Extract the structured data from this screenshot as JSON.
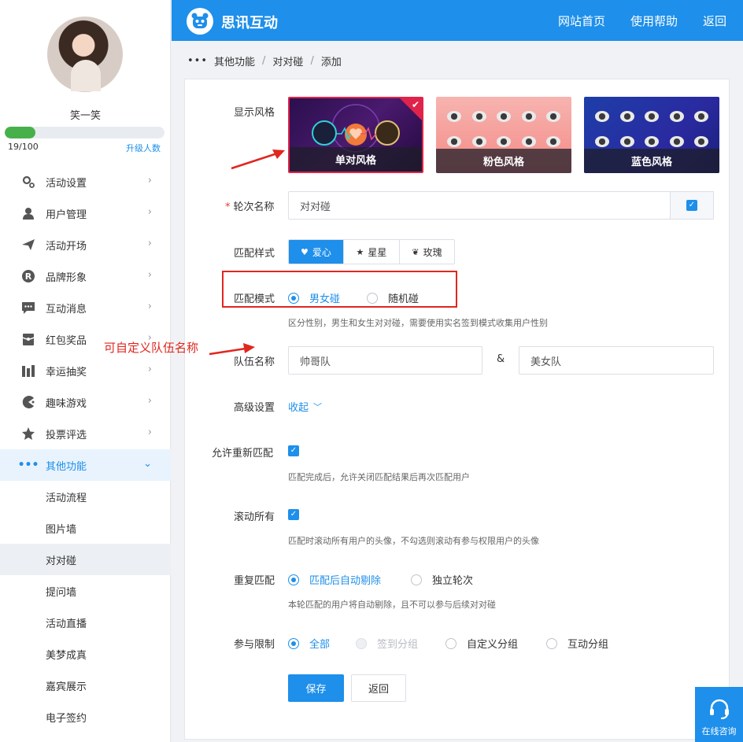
{
  "app": {
    "brand": "思讯互动",
    "accent": "#1e8fea",
    "annotation_color": "#e0271f"
  },
  "header": {
    "nav": [
      "网站首页",
      "使用帮助",
      "返回"
    ]
  },
  "user": {
    "name": "笑一笑",
    "count_text": "19/100",
    "progress": 0.19,
    "upgrade_label": "升级人数"
  },
  "sidebar": {
    "items": [
      {
        "label": "活动设置",
        "icon": "gear-icon"
      },
      {
        "label": "用户管理",
        "icon": "user-icon"
      },
      {
        "label": "活动开场",
        "icon": "paper-plane-icon"
      },
      {
        "label": "品牌形象",
        "icon": "registered-icon"
      },
      {
        "label": "互动消息",
        "icon": "chat-icon"
      },
      {
        "label": "红包奖品",
        "icon": "gift-icon"
      },
      {
        "label": "幸运抽奖",
        "icon": "lottery-icon"
      },
      {
        "label": "趣味游戏",
        "icon": "pacman-icon"
      },
      {
        "label": "投票评选",
        "icon": "star-icon"
      },
      {
        "label": "其他功能",
        "icon": "more-icon",
        "expanded": true
      }
    ],
    "sub_items": [
      "活动流程",
      "图片墙",
      "对对碰",
      "提问墙",
      "活动直播",
      "美梦成真",
      "嘉宾展示",
      "电子签约"
    ],
    "selected_sub": "对对碰"
  },
  "breadcrumb": [
    "其他功能",
    "对对碰",
    "添加"
  ],
  "form": {
    "display_style": {
      "label": "显示风格",
      "options": [
        "单对风格",
        "粉色风格",
        "蓝色风格"
      ],
      "selected": "单对风格"
    },
    "round_name": {
      "label": "轮次名称",
      "value": "对对碰"
    },
    "match_style": {
      "label": "匹配样式",
      "options": [
        "爱心",
        "星星",
        "玫瑰"
      ],
      "selected": "爱心"
    },
    "match_mode": {
      "label": "匹配模式",
      "options": [
        "男女碰",
        "随机碰"
      ],
      "selected": "男女碰",
      "hint": "区分性别，男生和女生对对碰，需要使用实名签到模式收集用户性别"
    },
    "team_name": {
      "label": "队伍名称",
      "team_a": "帅哥队",
      "separator": "&",
      "team_b": "美女队"
    },
    "advanced": {
      "label": "高级设置",
      "toggle": "收起"
    },
    "allow_rematch": {
      "label": "允许重新匹配",
      "checked": true,
      "hint": "匹配完成后，允许关闭匹配结果后再次匹配用户"
    },
    "scroll_all": {
      "label": "滚动所有",
      "checked": true,
      "hint": "匹配时滚动所有用户的头像，不勾选则滚动有参与权限用户的头像"
    },
    "repeat_match": {
      "label": "重复匹配",
      "options": [
        "匹配后自动剔除",
        "独立轮次"
      ],
      "selected": "匹配后自动剔除",
      "hint": "本轮匹配的用户将自动剔除，且不可以参与后续对对碰"
    },
    "participation": {
      "label": "参与限制",
      "options": [
        "全部",
        "签到分组",
        "自定义分组",
        "互动分组"
      ],
      "selected": "全部",
      "disabled": "签到分组"
    },
    "save_label": "保存",
    "back_label": "返回"
  },
  "annotation": {
    "text": "可自定义队伍名称"
  },
  "consult": {
    "label": "在线咨询"
  }
}
